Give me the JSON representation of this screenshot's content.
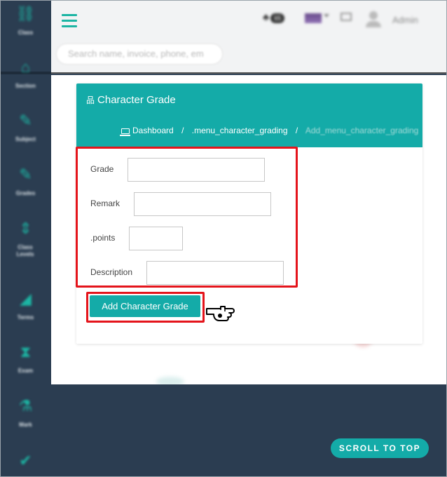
{
  "sidebar": {
    "items": [
      {
        "label": "Class",
        "icon": "sitemap-icon"
      },
      {
        "label": "Section",
        "icon": "home-icon"
      },
      {
        "label": "Subject",
        "icon": "edit-icon"
      },
      {
        "label": "Grades",
        "icon": "edit-icon"
      },
      {
        "label": "Class Levels",
        "icon": "sort-icon"
      },
      {
        "label": "Terms",
        "icon": "bar-chart-icon"
      },
      {
        "label": "Exam",
        "icon": "hourglass-icon"
      },
      {
        "label": "Mark",
        "icon": "flask-icon"
      },
      {
        "label": "",
        "icon": "check-circle-icon"
      }
    ]
  },
  "header": {
    "notifications_count": "65",
    "user_name": "Admin",
    "search_placeholder": "Search name, invoice, phone, em"
  },
  "card": {
    "title": "Character Grade",
    "breadcrumb": {
      "home": "Dashboard",
      "section": ".menu_character_grading",
      "current": "Add_menu_character_grading"
    }
  },
  "form": {
    "fields": [
      {
        "label": "Grade",
        "value": ""
      },
      {
        "label": "Remark",
        "value": ""
      },
      {
        "label": ".points",
        "value": ""
      },
      {
        "label": "Description",
        "value": ""
      }
    ],
    "submit_label": "Add Character Grade"
  },
  "footer": {
    "scroll_to_top": "SCROLL TO TOP"
  },
  "colors": {
    "accent": "#14aba8",
    "sidebar": "#2b3d51",
    "highlight": "#e4141b"
  }
}
